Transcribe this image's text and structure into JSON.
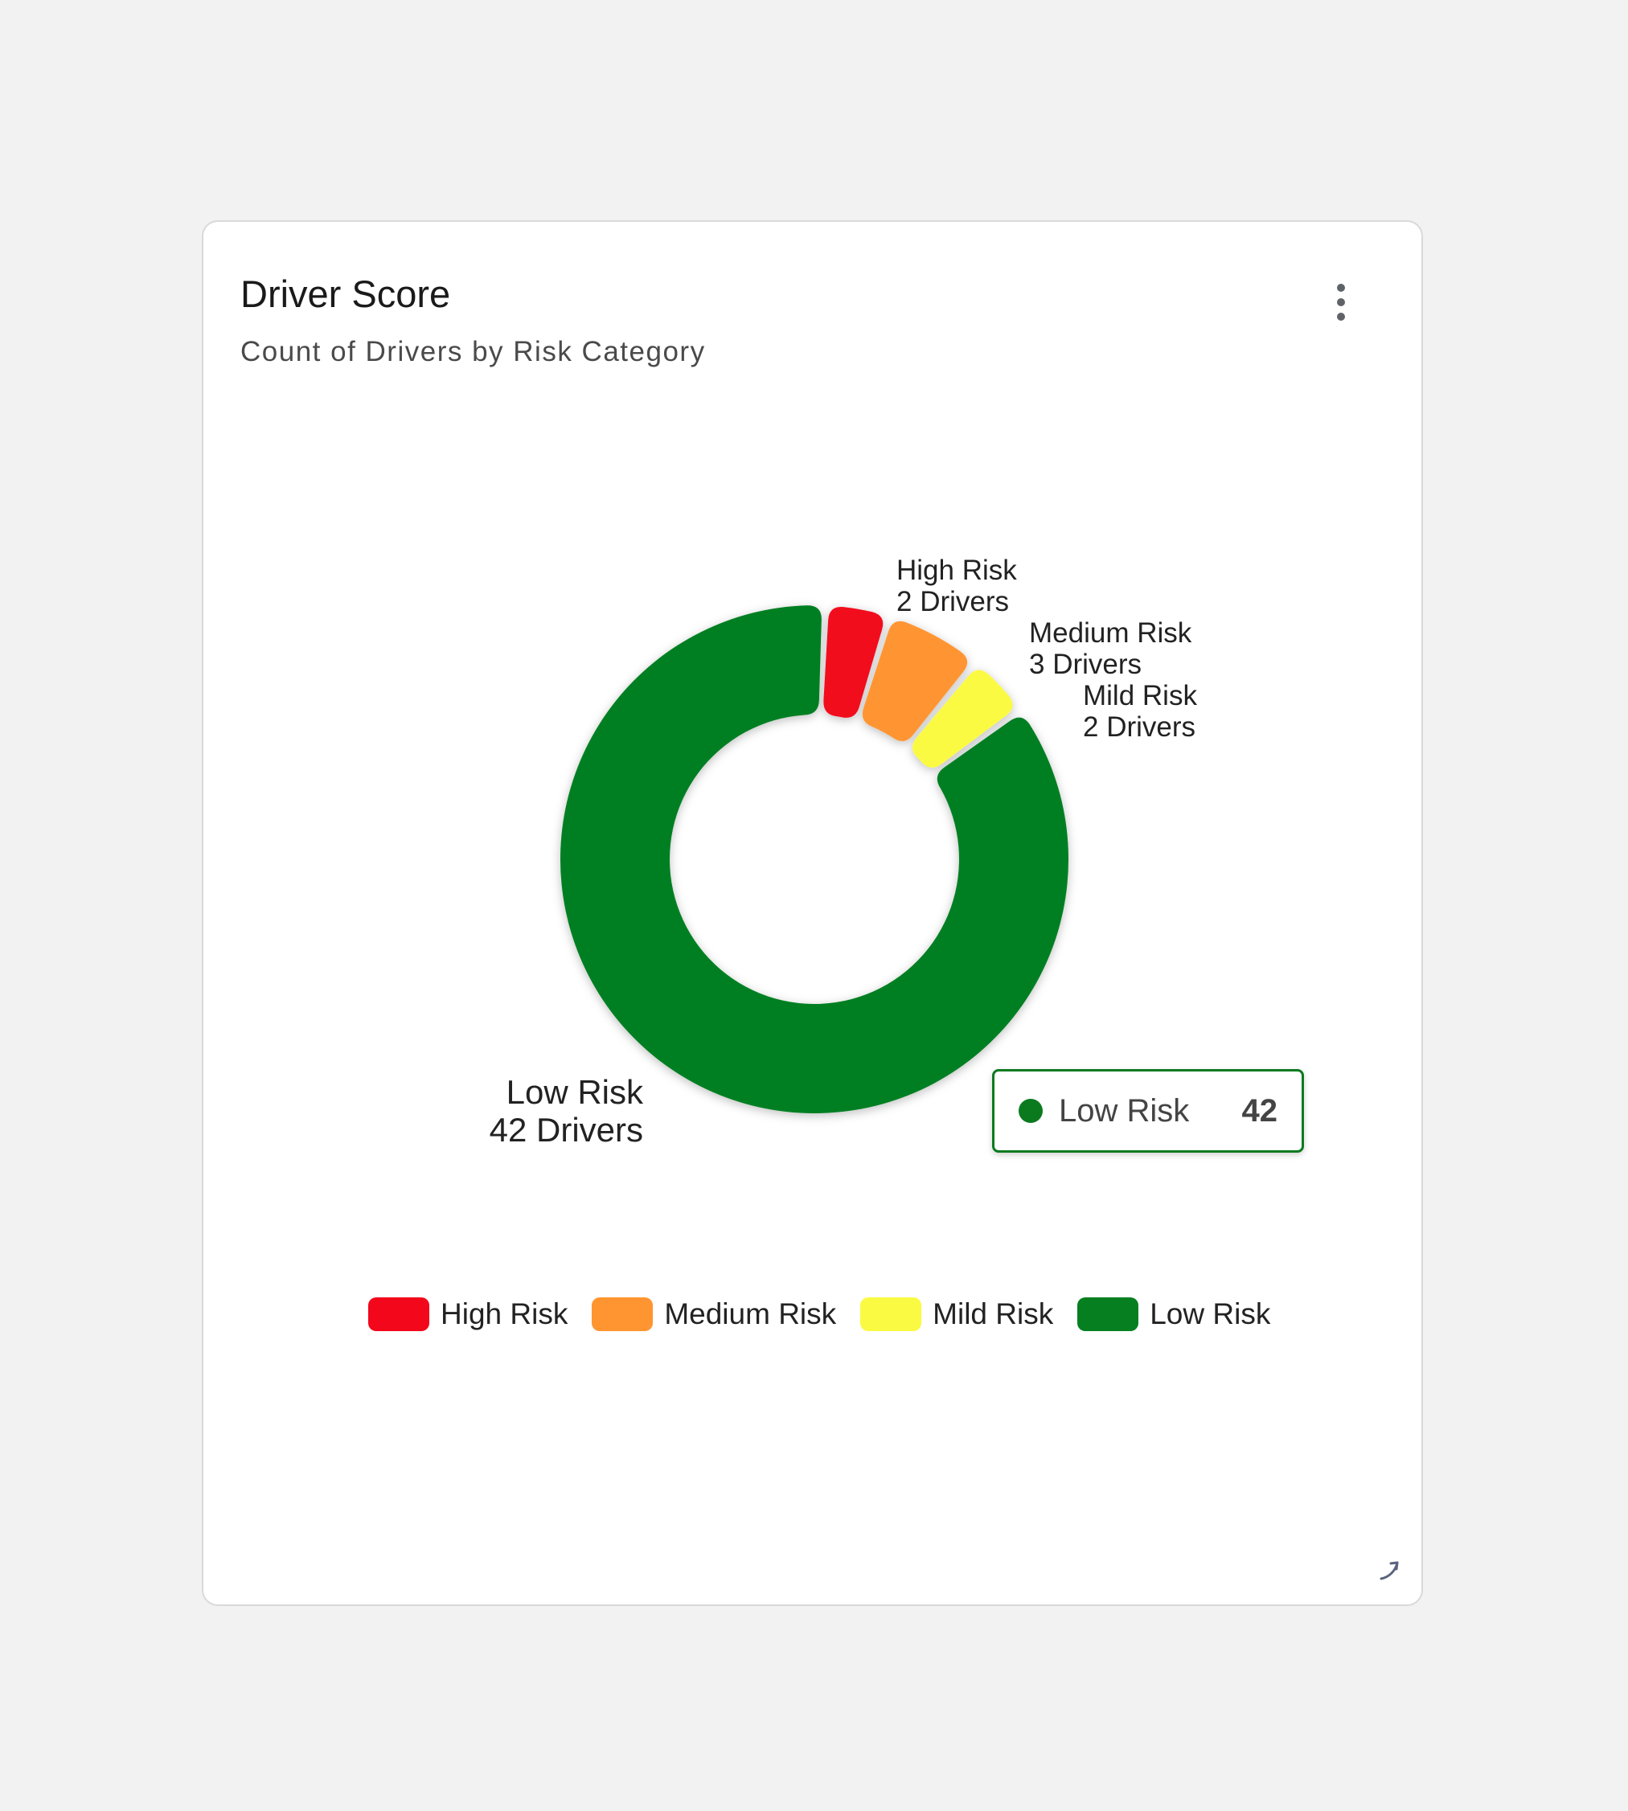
{
  "card": {
    "title": "Driver Score",
    "subtitle": "Count of Drivers by Risk Category",
    "menu_icon": "more-vertical-icon",
    "resize_icon": "resize-handle-icon"
  },
  "tooltip": {
    "label": "Low Risk",
    "value": "42",
    "color": "#0b7a1f"
  },
  "chart_data": {
    "type": "pie",
    "variant": "donut",
    "title": "Driver Score",
    "subtitle": "Count of Drivers by Risk Category",
    "categories": [
      "High Risk",
      "Medium Risk",
      "Mild Risk",
      "Low Risk"
    ],
    "values": [
      2,
      3,
      2,
      42
    ],
    "colors": [
      "#f2071b",
      "#ff9530",
      "#fbfa43",
      "#057f20"
    ],
    "slice_labels": [
      {
        "name": "High Risk",
        "detail": "2 Drivers"
      },
      {
        "name": "Medium Risk",
        "detail": "3 Drivers"
      },
      {
        "name": "Mild Risk",
        "detail": "2 Drivers"
      },
      {
        "name": "Low Risk",
        "detail": "42 Drivers"
      }
    ],
    "legend": {
      "position": "bottom",
      "items": [
        "High Risk",
        "Medium Risk",
        "Mild Risk",
        "Low Risk"
      ]
    }
  }
}
